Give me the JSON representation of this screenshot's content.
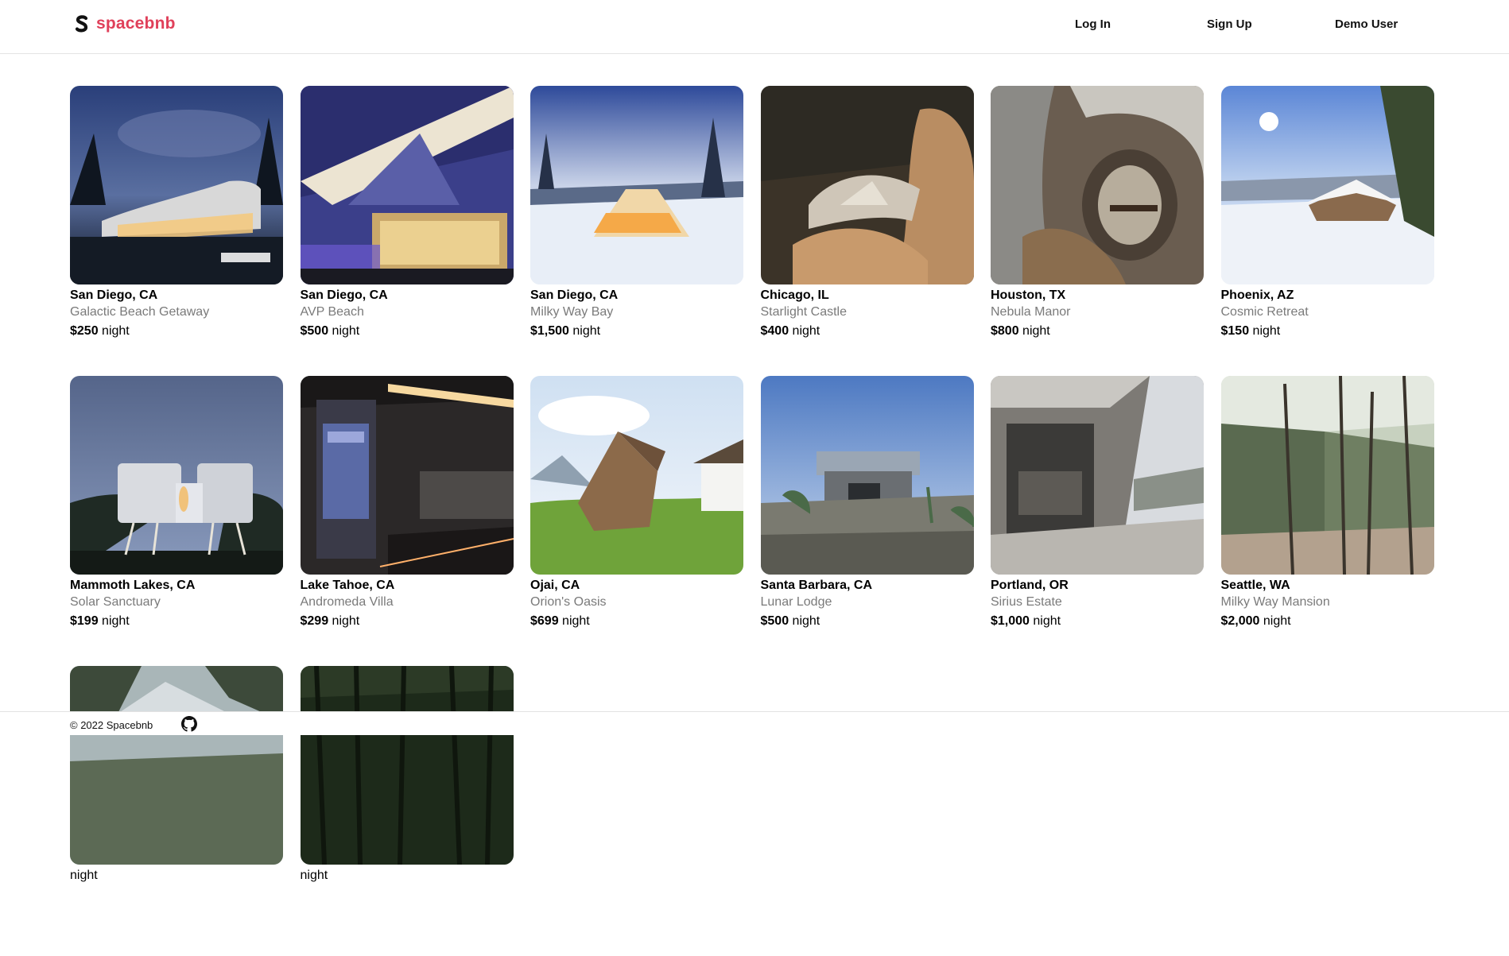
{
  "header": {
    "brand": "spacebnb",
    "login_label": "Log In",
    "signup_label": "Sign Up",
    "demo_label": "Demo User"
  },
  "colors": {
    "brand": "#e0405a"
  },
  "price_suffix": "night",
  "listings": [
    {
      "location": "San Diego, CA",
      "title": "Galactic Beach Getaway",
      "price": "$250",
      "image": "night-curved-house"
    },
    {
      "location": "San Diego, CA",
      "title": "AVP Beach",
      "price": "$500",
      "image": "triangle-modern-house"
    },
    {
      "location": "San Diego, CA",
      "title": "Milky Way Bay",
      "price": "$1,500",
      "image": "snow-cabin"
    },
    {
      "location": "Chicago, IL",
      "title": "Starlight Castle",
      "price": "$400",
      "image": "desert-rock-sculpture"
    },
    {
      "location": "Houston, TX",
      "title": "Nebula Manor",
      "price": "$800",
      "image": "organic-interior"
    },
    {
      "location": "Phoenix, AZ",
      "title": "Cosmic Retreat",
      "price": "$150",
      "image": "snowy-forest-house"
    },
    {
      "location": "Mammoth Lakes, CA",
      "title": "Solar Sanctuary",
      "price": "$199",
      "image": "stilt-pod-house"
    },
    {
      "location": "Lake Tahoe, CA",
      "title": "Andromeda Villa",
      "price": "$299",
      "image": "dark-kitchen"
    },
    {
      "location": "Ojai, CA",
      "title": "Orion's Oasis",
      "price": "$699",
      "image": "wooden-cabin"
    },
    {
      "location": "Santa Barbara, CA",
      "title": "Lunar Lodge",
      "price": "$500",
      "image": "desert-modern-house"
    },
    {
      "location": "Portland, OR",
      "title": "Sirius Estate",
      "price": "$1,000",
      "image": "glass-interior"
    },
    {
      "location": "Seattle, WA",
      "title": "Milky Way Mansion",
      "price": "$2,000",
      "image": "forest-mirror-house"
    },
    {
      "location": "",
      "title": "",
      "price": "",
      "image": "mountain-trees"
    },
    {
      "location": "",
      "title": "",
      "price": "",
      "image": "dark-forest"
    }
  ],
  "footer": {
    "copyright": "© 2022 Spacebnb",
    "github_icon": "github-icon"
  }
}
